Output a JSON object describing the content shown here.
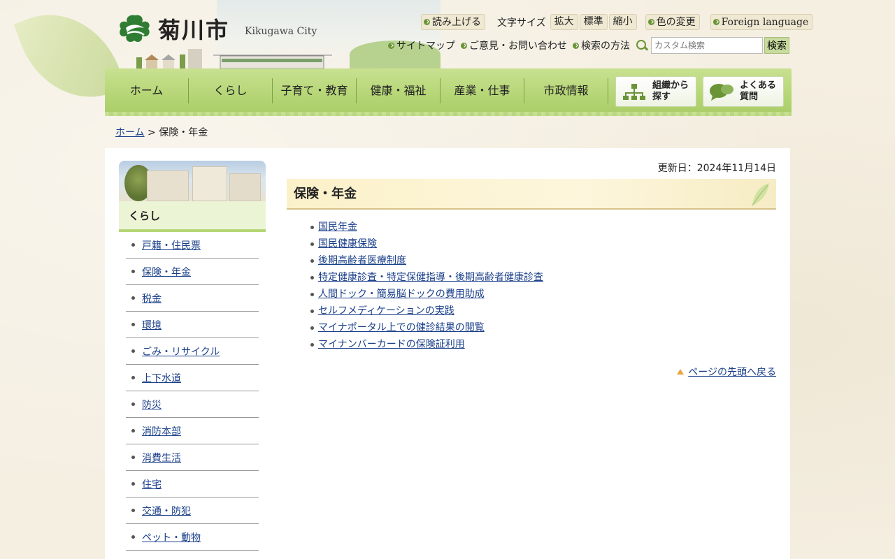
{
  "header": {
    "logo_text": "菊川市",
    "logo_en": "Kikugawa City"
  },
  "utility": {
    "read_aloud": "読み上げる",
    "font_size_label": "文字サイズ",
    "font_large": "拡大",
    "font_standard": "標準",
    "font_small": "縮小",
    "color_change": "色の変更",
    "foreign_language": "Foreign language",
    "sitemap": "サイトマップ",
    "feedback": "ご意見・お問い合わせ",
    "search_method": "検索の方法",
    "search_placeholder": "カスタム検索",
    "search_button": "検索"
  },
  "nav": {
    "items": [
      "ホーム",
      "くらし",
      "子育て・教育",
      "健康・福祉",
      "産業・仕事",
      "市政情報"
    ],
    "org_search": [
      "組織から",
      "探す"
    ],
    "faq": [
      "よくある",
      "質問"
    ]
  },
  "breadcrumb": {
    "home": "ホーム",
    "separator": " > ",
    "current": "保険・年金"
  },
  "sidebar": {
    "heading": "くらし",
    "items": [
      "戸籍・住民票",
      "保険・年金",
      "税金",
      "環境",
      "ごみ・リサイクル",
      "上下水道",
      "防災",
      "消防本部",
      "消費生活",
      "住宅",
      "交通・防犯",
      "ペット・動物"
    ]
  },
  "content": {
    "updated": "更新日：2024年11月14日",
    "title": "保険・年金",
    "links": [
      "国民年金",
      "国民健康保険",
      "後期高齢者医療制度",
      "特定健康診査・特定保健指導・後期高齢者健康診査",
      "人間ドック・簡易脳ドックの費用助成",
      "セルフメディケーションの実践",
      "マイナポータル上での健診結果の閲覧",
      "マイナンバーカードの保険証利用"
    ],
    "page_top": "ページの先頭へ戻る"
  }
}
